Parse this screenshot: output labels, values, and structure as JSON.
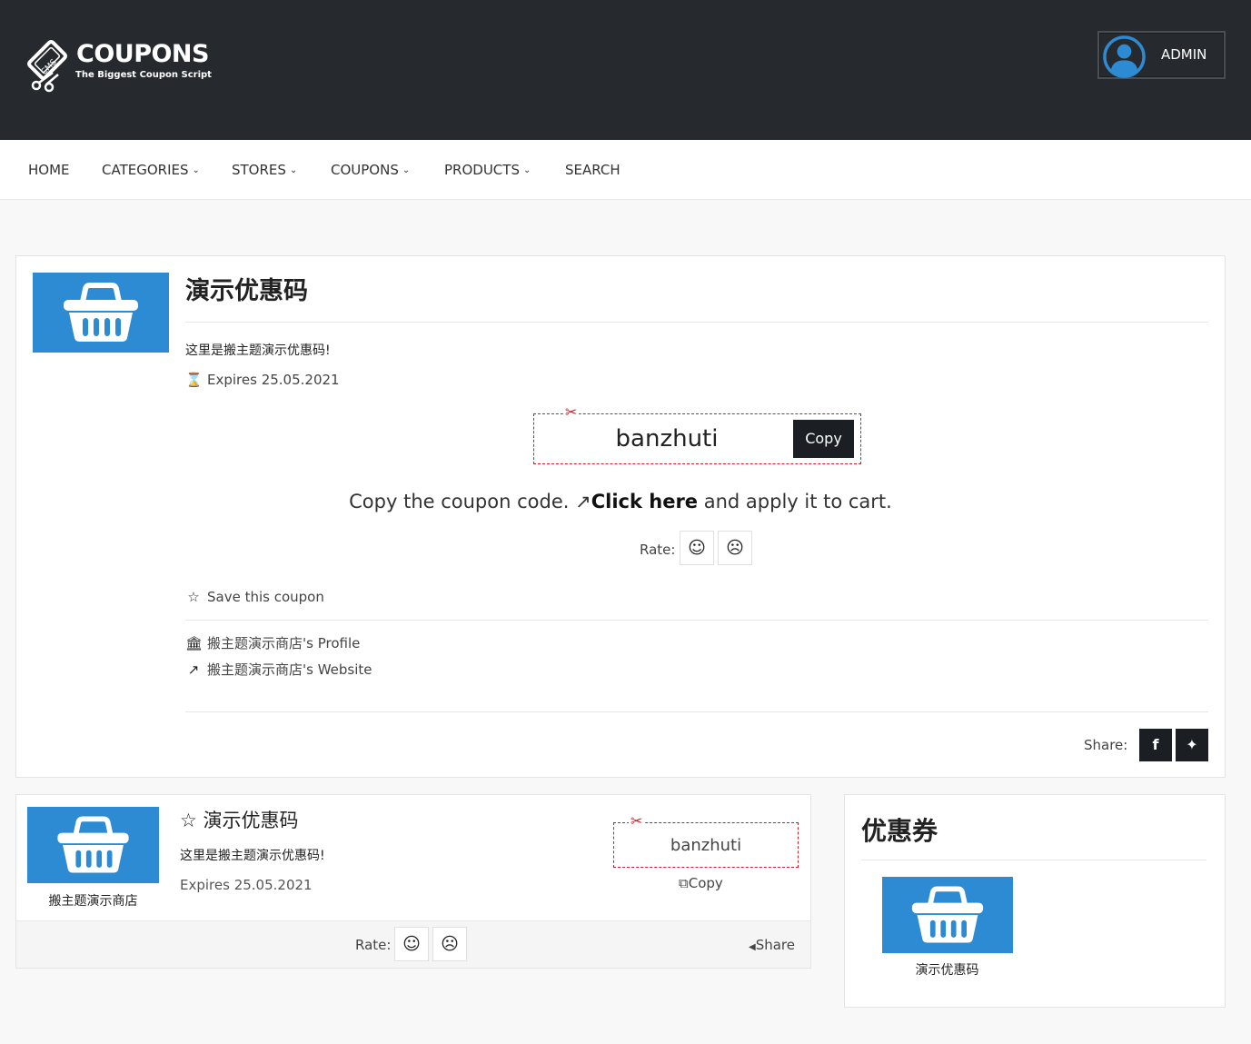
{
  "header": {
    "logo_title": "COUPONS",
    "logo_subtitle": "The Biggest Coupon Script",
    "logo_badge": "CMS",
    "admin_label": "ADMIN"
  },
  "nav": {
    "home": "HOME",
    "categories": "CATEGORIES",
    "stores": "STORES",
    "coupons": "COUPONS",
    "products": "PRODUCTS",
    "search": "SEARCH"
  },
  "coupon": {
    "title": "演示优惠码",
    "description": "这里是搬主题演示优惠码!",
    "expires": "Expires 25.05.2021",
    "code": "banzhuti",
    "copy_label": "Copy",
    "instruction_prefix": "Copy the coupon code.",
    "instruction_link": "Click here",
    "instruction_suffix": "and apply it to cart.",
    "rate_label": "Rate:",
    "save_label": "Save this coupon",
    "store_profile": "搬主题演示商店's Profile",
    "store_website": "搬主题演示商店's Website",
    "share_label": "Share:"
  },
  "listing": {
    "title": "演示优惠码",
    "description": "这里是搬主题演示优惠码!",
    "expires": "Expires 25.05.2021",
    "store_name": "搬主题演示商店",
    "code": "banzhuti",
    "copy_label": "Copy",
    "rate_label": "Rate:",
    "share_label": "Share"
  },
  "sidebar": {
    "title": "优惠券",
    "item_caption": "演示优惠码"
  },
  "colors": {
    "header_bg": "#262a2f",
    "thumb_blue": "#2d8bd3",
    "code_border": "#c4202a",
    "button_dark": "#1b1e22"
  }
}
